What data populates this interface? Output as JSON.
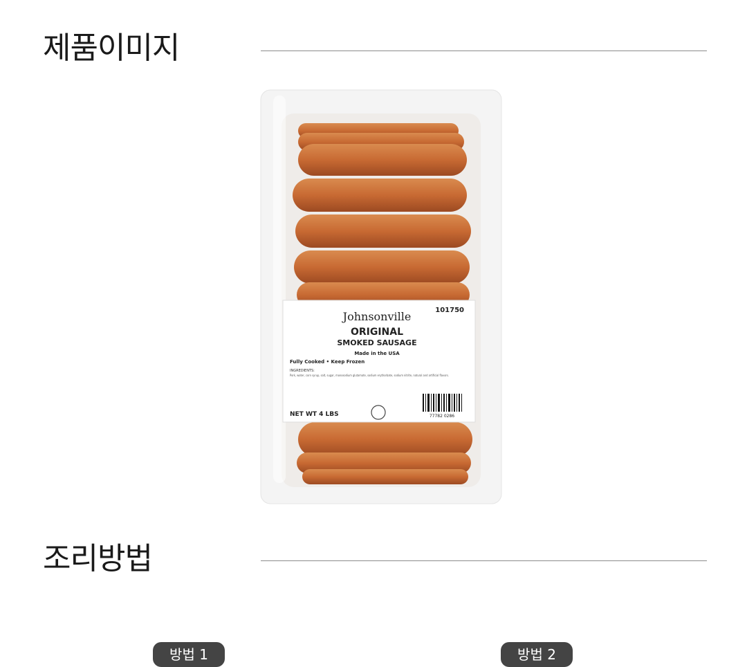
{
  "sections": {
    "product_image_title": "제품이미지",
    "cooking_title": "조리방법"
  },
  "methods": [
    "방법 1",
    "방법 2"
  ],
  "label": {
    "brand": "Johnsonville",
    "code": "101750",
    "line1": "ORIGINAL",
    "line2": "SMOKED SAUSAGE",
    "origin": "Made in the USA",
    "note": "Fully Cooked • Keep Frozen",
    "ingredients_heading": "INGREDIENTS:",
    "ingredients": "Pork, water, corn syrup, salt, sugar, monosodium glutamate, sodium erythorbate, sodium nitrite, natural and artificial flavors.",
    "net_wt": "NET WT 4 LBS",
    "barcode": "77782 0286"
  }
}
